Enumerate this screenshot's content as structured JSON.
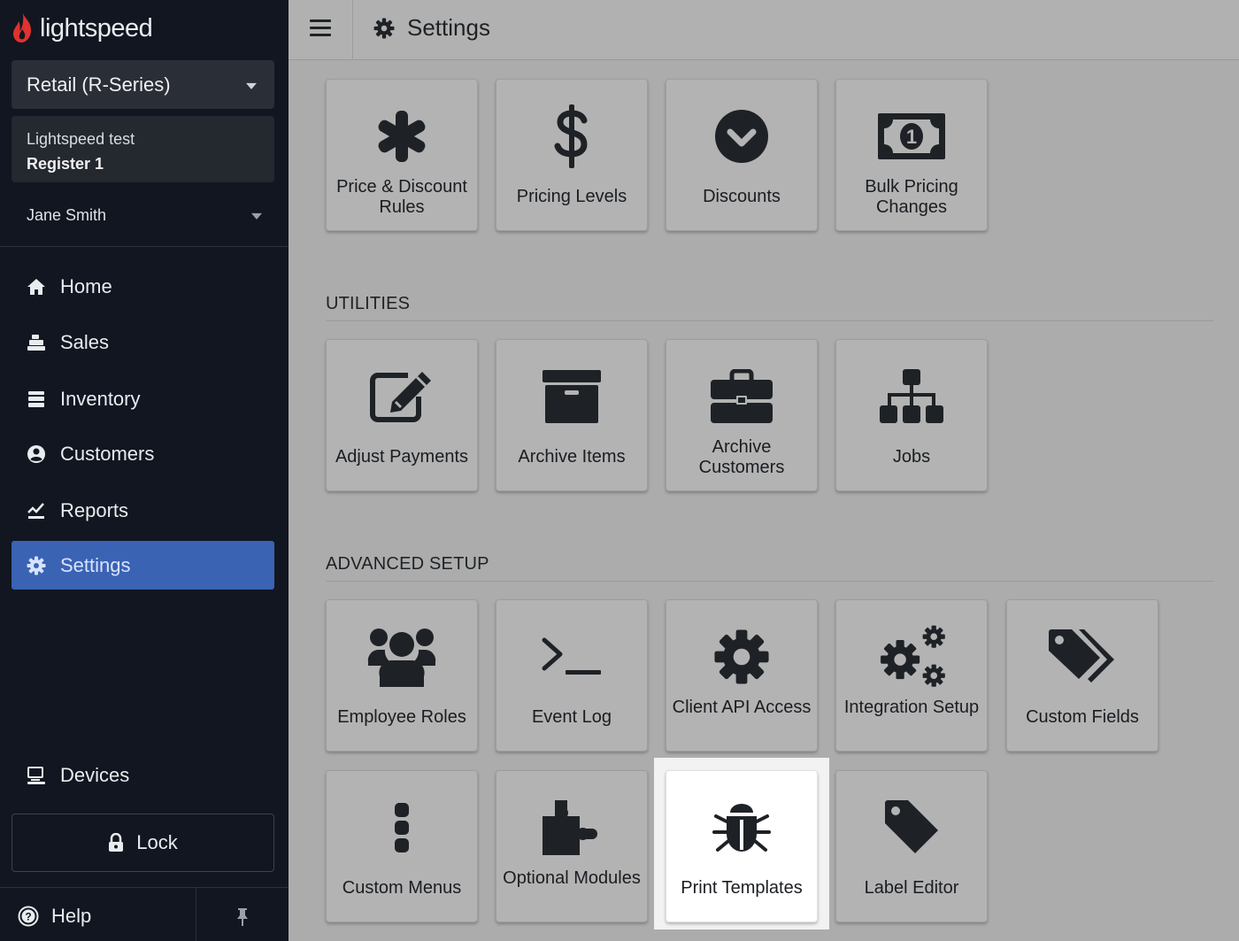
{
  "brand": {
    "name": "lightspeed"
  },
  "sidebar": {
    "product_selector": "Retail (R-Series)",
    "register": {
      "shop": "Lightspeed test",
      "register": "Register 1"
    },
    "user": "Jane Smith",
    "nav": [
      {
        "label": "Home",
        "icon": "home-icon"
      },
      {
        "label": "Sales",
        "icon": "register-icon"
      },
      {
        "label": "Inventory",
        "icon": "inventory-icon"
      },
      {
        "label": "Customers",
        "icon": "customer-icon"
      },
      {
        "label": "Reports",
        "icon": "chart-icon"
      },
      {
        "label": "Settings",
        "icon": "gear-icon",
        "active": true
      }
    ],
    "devices": "Devices",
    "lock": "Lock",
    "help": "Help"
  },
  "header": {
    "title": "Settings"
  },
  "sections": {
    "pricing": {
      "tiles": [
        {
          "label": "Price & Discount Rules",
          "icon": "asterisk-icon"
        },
        {
          "label": "Pricing Levels",
          "icon": "dollar-icon"
        },
        {
          "label": "Discounts",
          "icon": "chevron-circle-icon"
        },
        {
          "label": "Bulk Pricing Changes",
          "icon": "money-bill-icon"
        }
      ]
    },
    "utilities": {
      "title": "UTILITIES",
      "tiles": [
        {
          "label": "Adjust Payments",
          "icon": "edit-icon"
        },
        {
          "label": "Archive Items",
          "icon": "archive-icon"
        },
        {
          "label": "Archive Customers",
          "icon": "briefcase-icon"
        },
        {
          "label": "Jobs",
          "icon": "sitemap-icon"
        }
      ]
    },
    "advanced": {
      "title": "ADVANCED SETUP",
      "tiles": [
        {
          "label": "Employee Roles",
          "icon": "users-icon"
        },
        {
          "label": "Event Log",
          "icon": "terminal-icon"
        },
        {
          "label": "Client API Access",
          "icon": "cog-icon"
        },
        {
          "label": "Integration Setup",
          "icon": "cogs-icon"
        },
        {
          "label": "Custom Fields",
          "icon": "tags-icon"
        },
        {
          "label": "Custom Menus",
          "icon": "vertical-dots-icon"
        },
        {
          "label": "Optional Modules",
          "icon": "puzzle-icon"
        },
        {
          "label": "Print Templates",
          "icon": "bug-icon",
          "highlighted": true
        },
        {
          "label": "Label Editor",
          "icon": "tag-icon"
        }
      ]
    }
  }
}
